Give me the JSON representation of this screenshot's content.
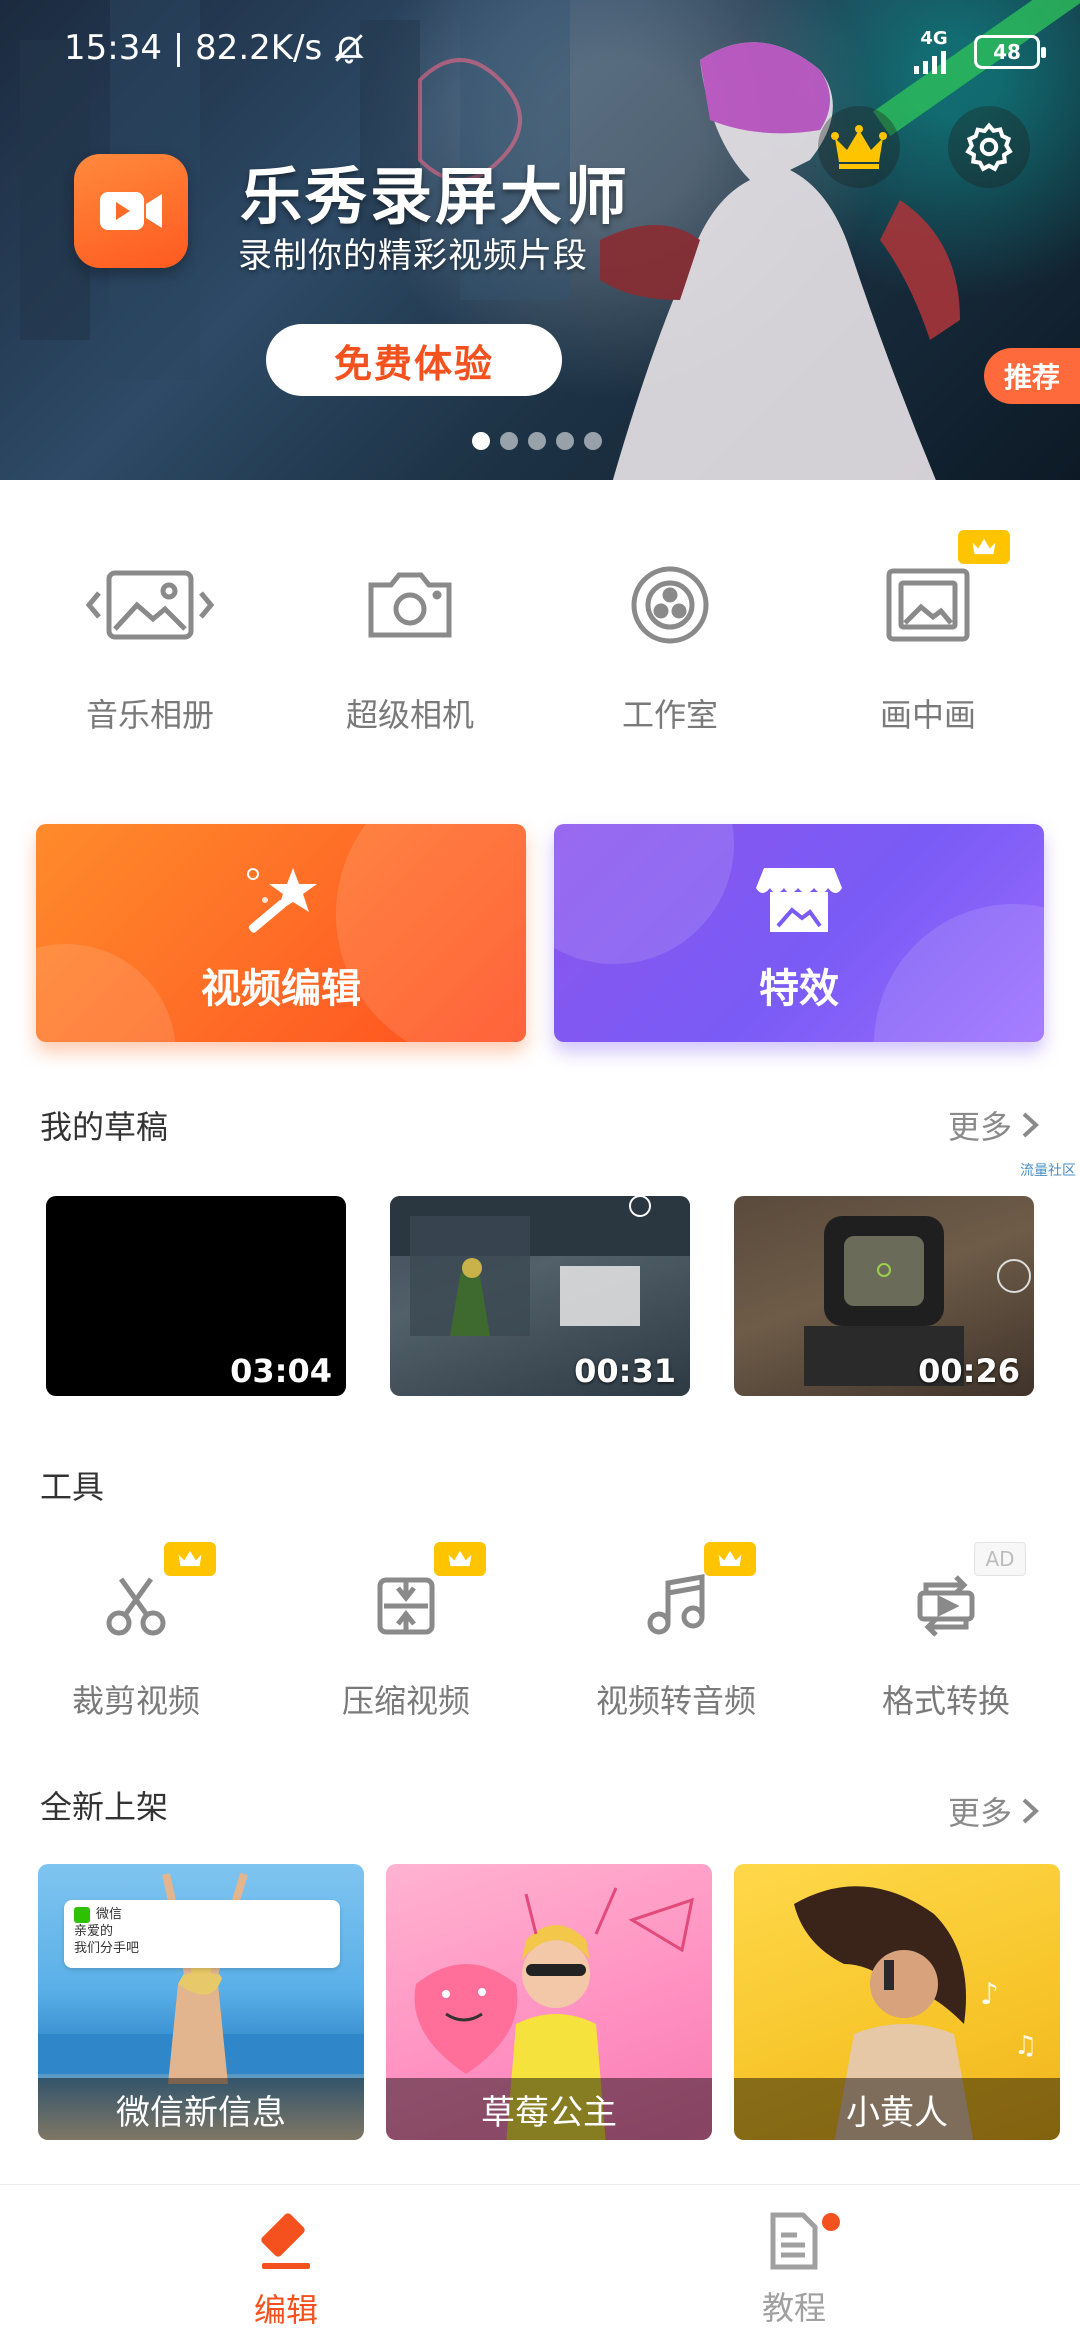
{
  "status_bar": {
    "time_speed": "15:34 | 82.2K/s",
    "network": "4G",
    "battery": "48"
  },
  "banner": {
    "title": "乐秀录屏大师",
    "subtitle": "录制你的精彩视频片段",
    "cta": "免费体验",
    "tag": "推荐",
    "active_dot": 0,
    "dot_count": 5
  },
  "quick_entries": [
    {
      "label": "音乐相册",
      "icon": "photo-slideshow-icon"
    },
    {
      "label": "超级相机",
      "icon": "camera-icon"
    },
    {
      "label": "工作室",
      "icon": "film-reel-icon"
    },
    {
      "label": "画中画",
      "icon": "picture-in-picture-icon",
      "vip": true
    }
  ],
  "cards": {
    "edit_label": "视频编辑",
    "effect_label": "特效"
  },
  "drafts": {
    "title": "我的草稿",
    "more": "更多",
    "side_ad": "流量社区",
    "items": [
      {
        "duration": "03:04"
      },
      {
        "duration": "00:31"
      },
      {
        "duration": "00:26"
      }
    ]
  },
  "tools": {
    "title": "工具",
    "items": [
      {
        "label": "裁剪视频",
        "icon": "scissors-icon",
        "vip": true
      },
      {
        "label": "压缩视频",
        "icon": "compress-icon",
        "vip": true
      },
      {
        "label": "视频转音频",
        "icon": "music-note-icon",
        "vip": true
      },
      {
        "label": "格式转换",
        "icon": "convert-icon",
        "badge": "AD"
      }
    ]
  },
  "new_arrivals": {
    "title": "全新上架",
    "more": "更多",
    "items": [
      {
        "label": "微信新信息",
        "note_app": "微信",
        "note_line1": "亲爱的",
        "note_line2": "我们分手吧"
      },
      {
        "label": "草莓公主"
      },
      {
        "label": "小黄人"
      }
    ]
  },
  "bottom_nav": {
    "edit": "编辑",
    "tutorial": "教程"
  },
  "colors": {
    "accent": "#f4511e",
    "purple": "#7a5bf5",
    "vip_gold": "#ffc400"
  }
}
